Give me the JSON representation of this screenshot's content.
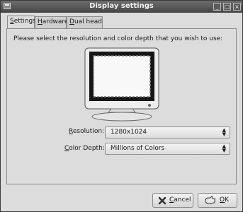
{
  "window": {
    "title": "Display settings"
  },
  "tabs": [
    {
      "label": "Settings",
      "mnemonic": "S",
      "rest": "ettings",
      "active": true
    },
    {
      "label": "Hardware",
      "mnemonic": "H",
      "rest": "ardware",
      "active": false
    },
    {
      "label": "Dual head",
      "mnemonic": "D",
      "rest": "ual head",
      "active": false
    }
  ],
  "settings": {
    "prompt": "Please select the resolution and color depth that you wish to use:",
    "resolution": {
      "label": "Resolution:",
      "mnemonic": "R",
      "rest": "esolution:",
      "value": "1280x1024"
    },
    "color_depth": {
      "label": "Color Depth:",
      "mnemonic": "C",
      "rest": "olor Depth:",
      "value": "Millions of Colors"
    }
  },
  "buttons": {
    "cancel": {
      "label": "Cancel",
      "mnemonic": "C",
      "rest": "ancel",
      "icon": "cancel-x-icon"
    },
    "ok": {
      "label": "OK",
      "mnemonic": "O",
      "rest": "K",
      "icon": "ok-hand-icon"
    }
  },
  "colors": {
    "titlebar": "#555555",
    "window_bg": "#dcdcdc"
  }
}
